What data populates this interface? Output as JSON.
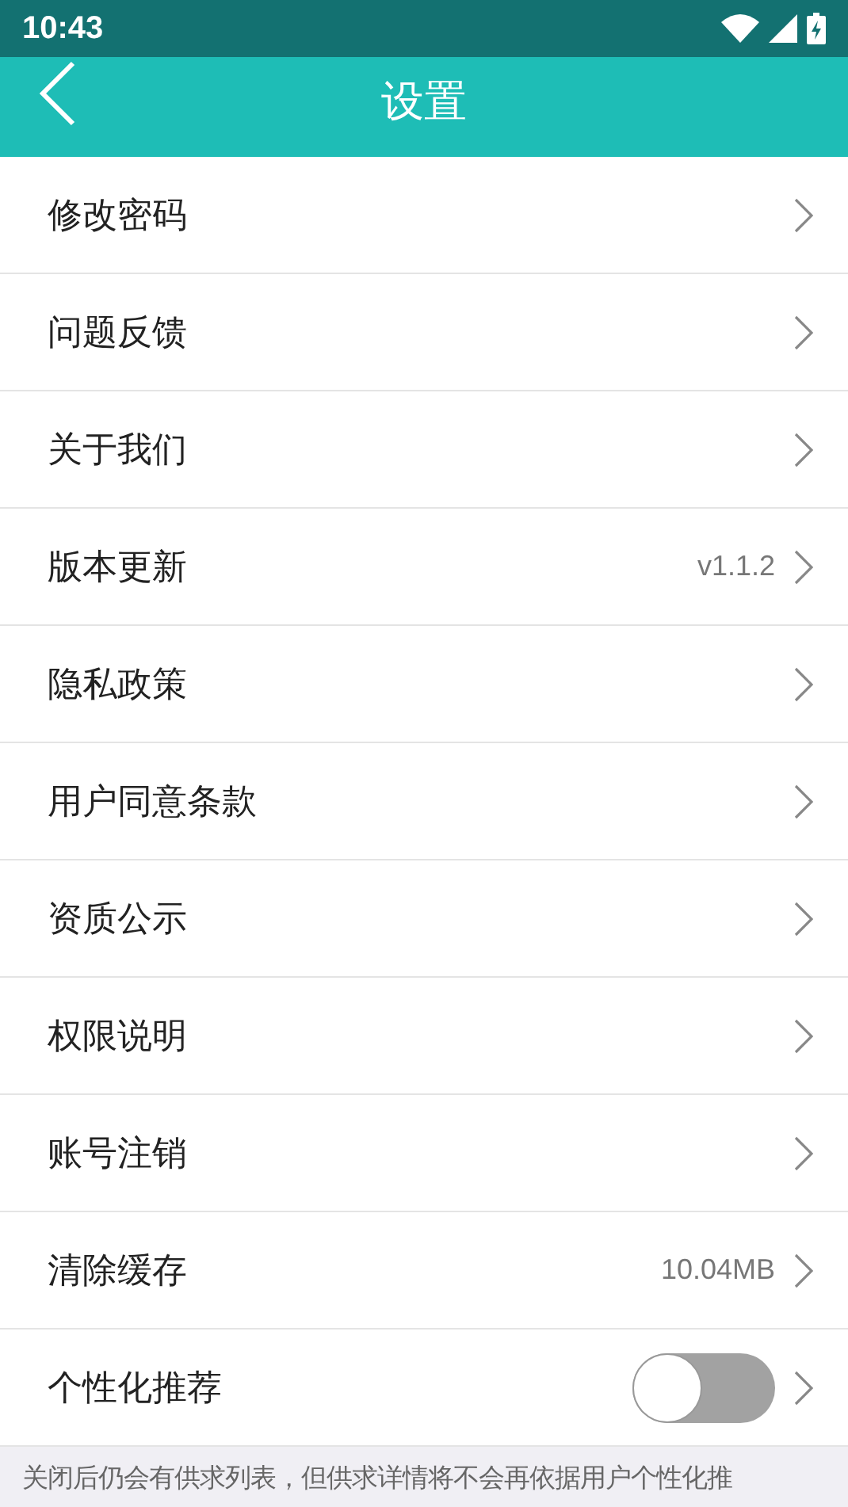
{
  "status_bar": {
    "time": "10:43"
  },
  "header": {
    "title": "设置"
  },
  "rows": [
    {
      "kind": "link",
      "label": "修改密码"
    },
    {
      "kind": "link",
      "label": "问题反馈"
    },
    {
      "kind": "link",
      "label": "关于我们"
    },
    {
      "kind": "value",
      "label": "版本更新",
      "value": "v1.1.2"
    },
    {
      "kind": "link",
      "label": "隐私政策"
    },
    {
      "kind": "link",
      "label": "用户同意条款"
    },
    {
      "kind": "link",
      "label": "资质公示"
    },
    {
      "kind": "link",
      "label": "权限说明"
    },
    {
      "kind": "link",
      "label": "账号注销"
    },
    {
      "kind": "value",
      "label": "清除缓存",
      "value": "10.04MB"
    },
    {
      "kind": "toggle",
      "label": "个性化推荐",
      "on": false
    }
  ],
  "note": "关闭后仍会有供求列表，但供求详情将不会再依据用户个性化推"
}
